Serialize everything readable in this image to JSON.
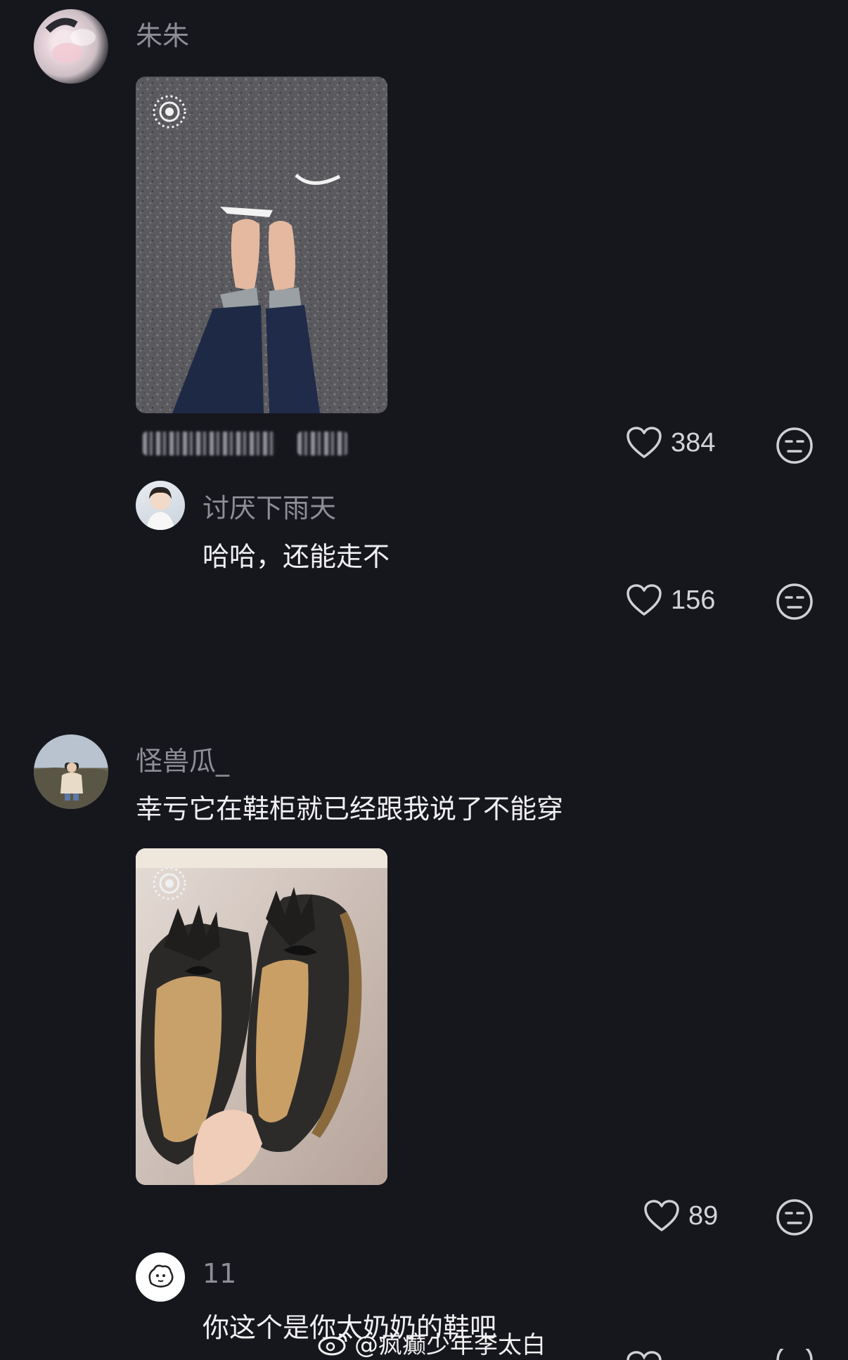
{
  "comments": [
    {
      "username": "朱朱",
      "likes": "384"
    },
    {
      "username": "讨厌下雨天",
      "text": "哈哈，还能走不",
      "likes": "156"
    },
    {
      "username": "怪兽瓜_",
      "text": "幸亏它在鞋柜就已经跟我说了不能穿",
      "likes": "89"
    },
    {
      "username": "11",
      "text": "你这个是你太奶奶的鞋吧"
    }
  ],
  "watermark": {
    "text": "@疯癫少年李太白"
  },
  "colors": {
    "background": "#16161d",
    "username": "#8e8e96",
    "text": "#f0f0f2",
    "icon": "#cfcfd4"
  }
}
